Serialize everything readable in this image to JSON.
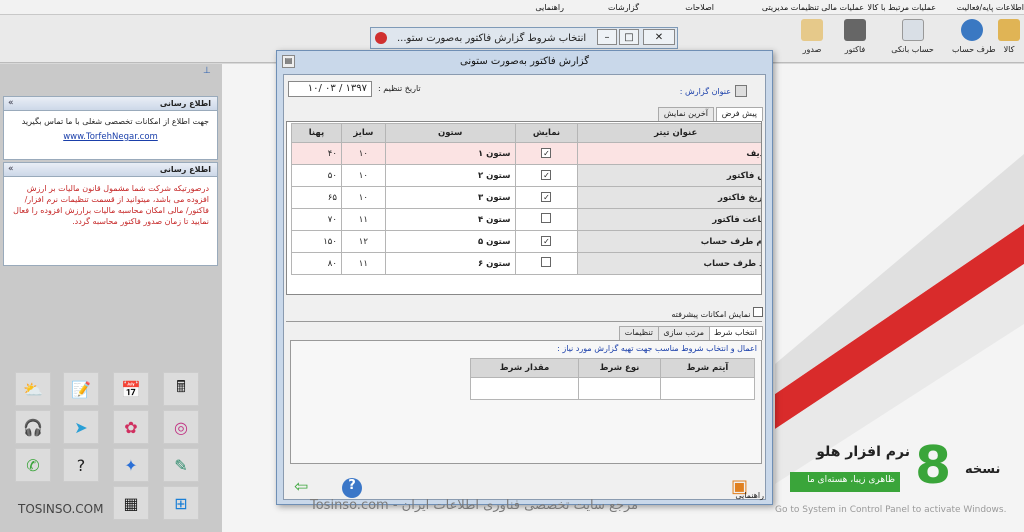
{
  "menu": [
    "اطلاعات پایه/فعالیت",
    "عملیات مرتبط با کالا",
    "عملیات مالی",
    "تنظیمات مدیریتی",
    "اصلاحات",
    "گزارشات",
    "راهنمایی"
  ],
  "toolbar": [
    "کالا",
    "طرف حساب",
    "حساب بانکی",
    "فاکتور",
    "صدور"
  ],
  "behind_window": {
    "title": "انتخاب شروط گزارش فاکتور به‌صورت ستو..."
  },
  "dialog": {
    "title": "گزارش فاکتور به‌صورت ستونی",
    "date_label": "تاریخ تنظیم :",
    "date_value": "۱۳۹۷ / ۰۳ /۱۰",
    "report_title_label": "عنوان گزارش :",
    "tabs": [
      "پیش فرض",
      "آخرین نمایش"
    ],
    "columns": [
      "عنوان تیتر",
      "نمایش",
      "ستون",
      "سایز",
      "پهنا"
    ],
    "rows": [
      {
        "title": "ردیف",
        "show": true,
        "col": "ستون ۱",
        "size": "۱۰",
        "width": "۴۰"
      },
      {
        "title": "ش فاکتور",
        "show": true,
        "col": "ستون ۲",
        "size": "۱۰",
        "width": "۵۰"
      },
      {
        "title": "تاریخ فاکتور",
        "show": true,
        "col": "ستون ۳",
        "size": "۱۰",
        "width": "۶۵"
      },
      {
        "title": "ساعت فاکتور",
        "show": false,
        "col": "ستون ۴",
        "size": "۱۱",
        "width": "۷۰"
      },
      {
        "title": "نام طرف حساب",
        "show": true,
        "col": "ستون ۵",
        "size": "۱۲",
        "width": "۱۵۰"
      },
      {
        "title": "کد طرف حساب",
        "show": false,
        "col": "ستون ۶",
        "size": "۱۱",
        "width": "۸۰"
      }
    ],
    "advanced_label": "نمایش امکانات پیشرفته",
    "lower_tabs": [
      "انتخاب شرط",
      "مرتب سازی",
      "تنظیمات"
    ],
    "condition_hint": "اعمال و انتخاب شروط مناسب جهت تهیه گزارش مورد نیاز :",
    "condition_columns": [
      "آیتم شرط",
      "نوع شرط",
      "مقدار شرط"
    ],
    "bottom_label": "راهنمایی"
  },
  "left": {
    "panel1": {
      "title": "اطلاع رسانی",
      "text": "جهت اطلاع از امکانات تخصصی شغلی با ما تماس بگیرید",
      "link": "www.TorfehNegar.com"
    },
    "panel2": {
      "title": "اطلاع رسانی",
      "text": "درصورتیکه شرکت شما مشمول قانون مالیات بر ارزش افزوده می باشد، میتوانید از قسمت تنظیمات نرم افزار/ فاکتور/ مالی امکان محاسبه مالیات برارزش افزوده را فعال نمایید تا زمان صدور فاکتور محاسبه گردد."
    }
  },
  "brand": {
    "version_word": "نسخه",
    "version_number": "8",
    "product": "نرم افزار هلو",
    "slogan": "ظاهری زیبا، هسته‌ای ما",
    "activate": "Go to System in Control Panel to activate Windows."
  },
  "watermark": {
    "left": "TOSINSO.COM",
    "center": "Tosinso.com - مرجع سایت تخصصی فناوری اطلاعات ایران"
  },
  "colors": {
    "brand_green": "#3aa53a",
    "title_bg": "#c9d8ea",
    "row_pink": "#fbe3e3"
  }
}
